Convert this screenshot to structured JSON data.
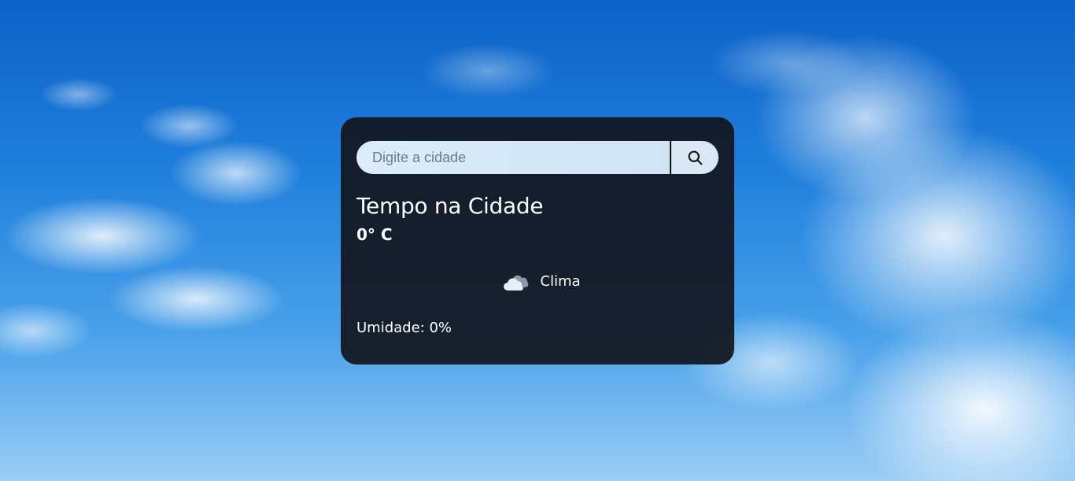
{
  "search": {
    "placeholder": "Digite a cidade",
    "value": "",
    "button_icon": "search-icon"
  },
  "weather": {
    "title": "Tempo na Cidade",
    "temperature": "0° C",
    "condition_icon": "cloud-icon",
    "condition_label": "Clima",
    "humidity": "Umidade: 0%"
  },
  "colors": {
    "card_background": "#12161e",
    "search_background": "#d8e8f5",
    "text": "#ffffff"
  }
}
